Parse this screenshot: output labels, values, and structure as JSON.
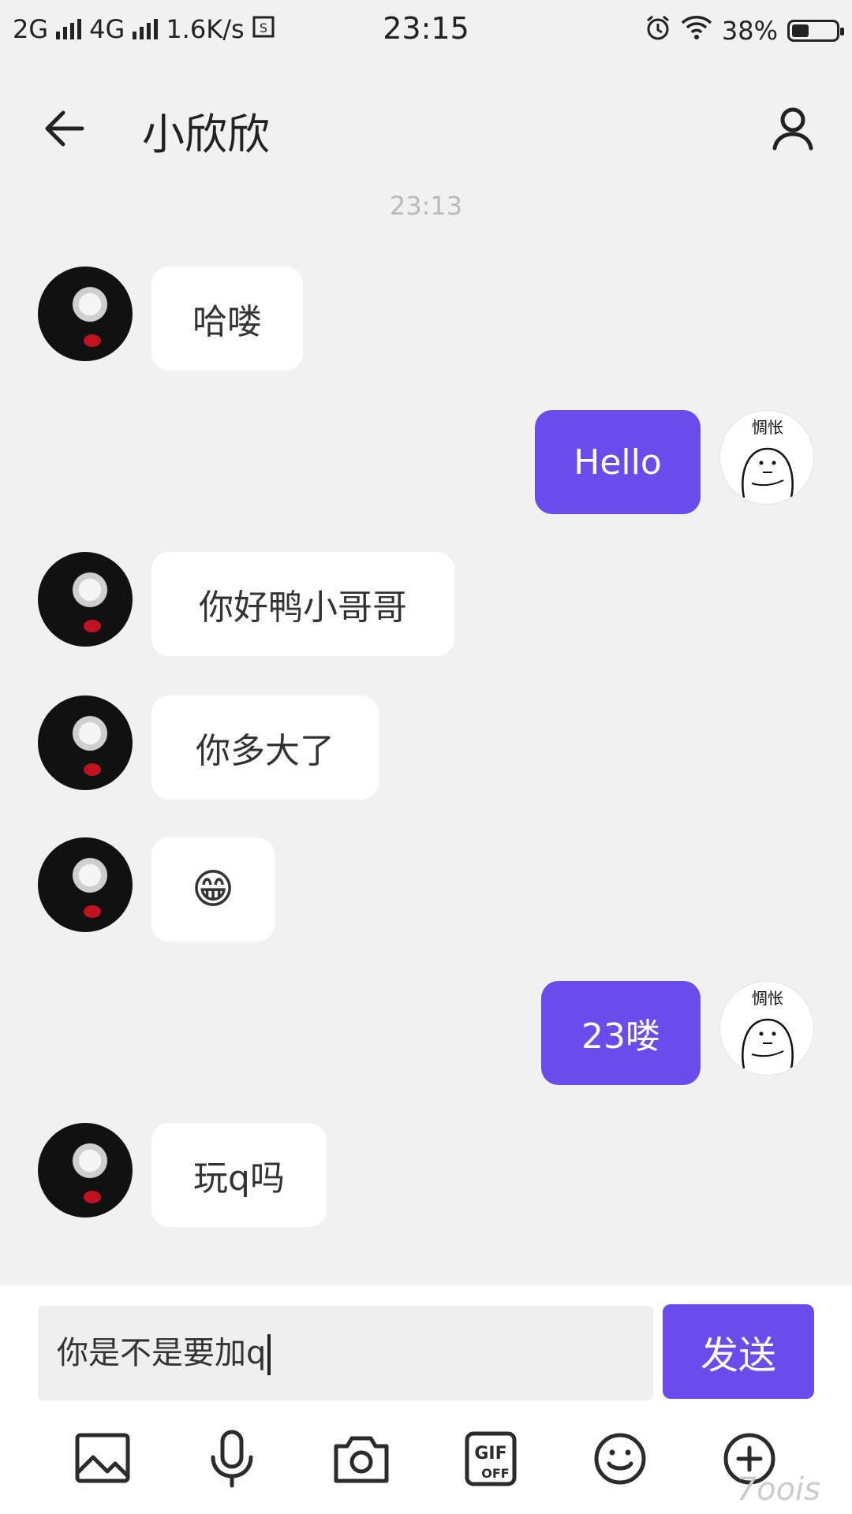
{
  "status_bar": {
    "network1": "2G",
    "network2": "4G",
    "speed": "1.6K/s",
    "time": "23:15",
    "battery": "38%",
    "battery_level": 0.38
  },
  "header": {
    "title": "小欣欣",
    "back_icon": "arrow-left-icon",
    "profile_icon": "person-icon"
  },
  "timestamp": "23:13",
  "messages": [
    {
      "side": "in",
      "text": "哈喽"
    },
    {
      "side": "out",
      "text": "Hello"
    },
    {
      "side": "in",
      "text": "你好鸭小哥哥"
    },
    {
      "side": "in",
      "text": "你多大了"
    },
    {
      "side": "in",
      "text": "😁"
    },
    {
      "side": "out",
      "text": "23喽"
    },
    {
      "side": "in",
      "text": "玩q吗"
    }
  ],
  "avatar_out_label": "惆怅",
  "composer": {
    "input_value": "你是不是要加q",
    "send_label": "发送"
  },
  "toolbar": [
    "image-icon",
    "microphone-icon",
    "camera-icon",
    "gif-off-icon",
    "emoji-icon",
    "plus-circle-icon"
  ],
  "gif_label_top": "GIF",
  "gif_label_bottom": "OFF",
  "watermark": "7oois",
  "colors": {
    "accent": "#6a4cec",
    "background": "#f1f1f1",
    "bubble_in": "#ffffff"
  }
}
